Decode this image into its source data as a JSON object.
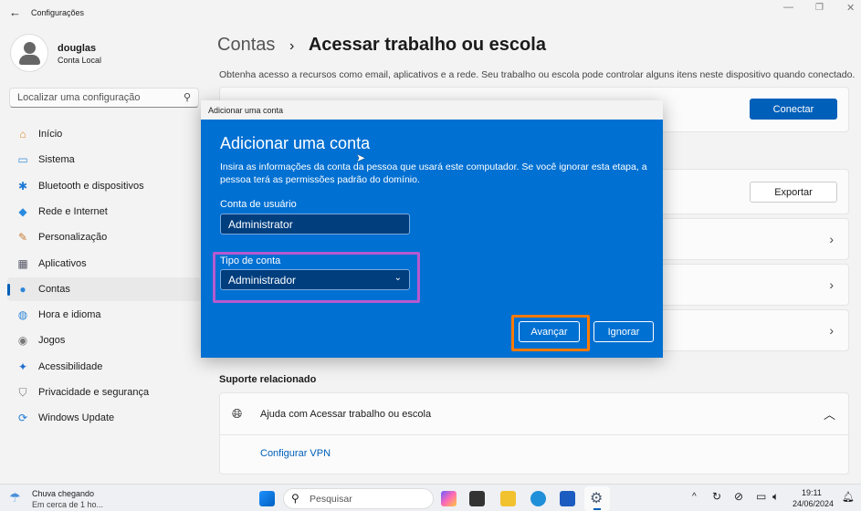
{
  "window": {
    "title": "Configurações"
  },
  "user": {
    "name": "douglas",
    "type": "Conta Local"
  },
  "search": {
    "placeholder": "Localizar uma configuração"
  },
  "sidebar": {
    "items": [
      {
        "label": "Início",
        "icon": "home-icon"
      },
      {
        "label": "Sistema",
        "icon": "system-icon"
      },
      {
        "label": "Bluetooth e dispositivos",
        "icon": "bluetooth-icon"
      },
      {
        "label": "Rede e Internet",
        "icon": "wifi-icon"
      },
      {
        "label": "Personalização",
        "icon": "brush-icon"
      },
      {
        "label": "Aplicativos",
        "icon": "apps-icon"
      },
      {
        "label": "Contas",
        "icon": "person-icon",
        "active": true
      },
      {
        "label": "Hora e idioma",
        "icon": "globe-icon"
      },
      {
        "label": "Jogos",
        "icon": "gamepad-icon"
      },
      {
        "label": "Acessibilidade",
        "icon": "accessibility-icon"
      },
      {
        "label": "Privacidade e segurança",
        "icon": "shield-icon"
      },
      {
        "label": "Windows Update",
        "icon": "update-icon"
      }
    ]
  },
  "header": {
    "crumb": "Contas",
    "separator": "›",
    "title": "Acessar trabalho ou escola",
    "description": "Obtenha acesso a recursos como email, aplicativos e a rede. Seu trabalho ou escola pode controlar alguns itens neste dispositivo quando conectado."
  },
  "main": {
    "connect_label": "Conectar",
    "export_label": "Exportar",
    "related_heading": "Suporte relacionado",
    "help_label": "Ajuda com Acessar trabalho ou escola",
    "vpn_link": "Configurar VPN"
  },
  "dialog": {
    "window_title": "Adicionar uma conta",
    "heading": "Adicionar uma conta",
    "text": "Insira as informações da conta da pessoa que usará este computador. Se você ignorar esta etapa, a pessoa terá as permissões padrão do domínio.",
    "user_label": "Conta de usuário",
    "user_value": "Administrator",
    "type_label": "Tipo de conta",
    "type_value": "Administrador",
    "next_label": "Avançar",
    "skip_label": "Ignorar"
  },
  "taskbar": {
    "weather_title": "Chuva chegando",
    "weather_sub": "Em cerca de 1 ho...",
    "search_placeholder": "Pesquisar",
    "time": "19:11",
    "date": "24/06/2024"
  },
  "colors": {
    "accent": "#005fb8",
    "dialog": "#0070d2",
    "highlight_purple": "#b65ad0",
    "highlight_orange": "#ff7a00"
  }
}
